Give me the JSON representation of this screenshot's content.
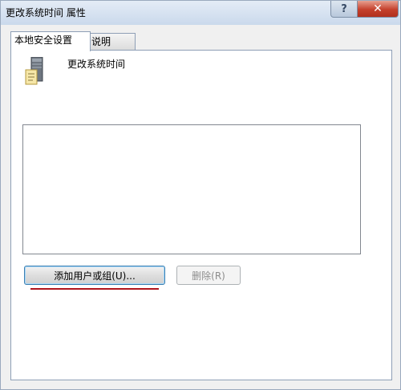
{
  "window": {
    "title": "更改系统时间 属性",
    "help_glyph": "?",
    "close_glyph": "✕"
  },
  "tabs": [
    {
      "label": "本地安全设置",
      "active": true
    },
    {
      "label": "说明",
      "active": false
    }
  ],
  "policy": {
    "name": "更改系统时间",
    "icon": "server-policy-icon"
  },
  "user_list": {
    "items": []
  },
  "buttons": {
    "add_label": "添加用户或组(U)...",
    "remove_label": "删除(R)",
    "remove_enabled": false
  },
  "colors": {
    "title_gradient_top": "#e4ecf6",
    "close_button_red": "#c4402c",
    "annotation_underline": "#b0141c",
    "panel_border": "#8e9fb6"
  }
}
